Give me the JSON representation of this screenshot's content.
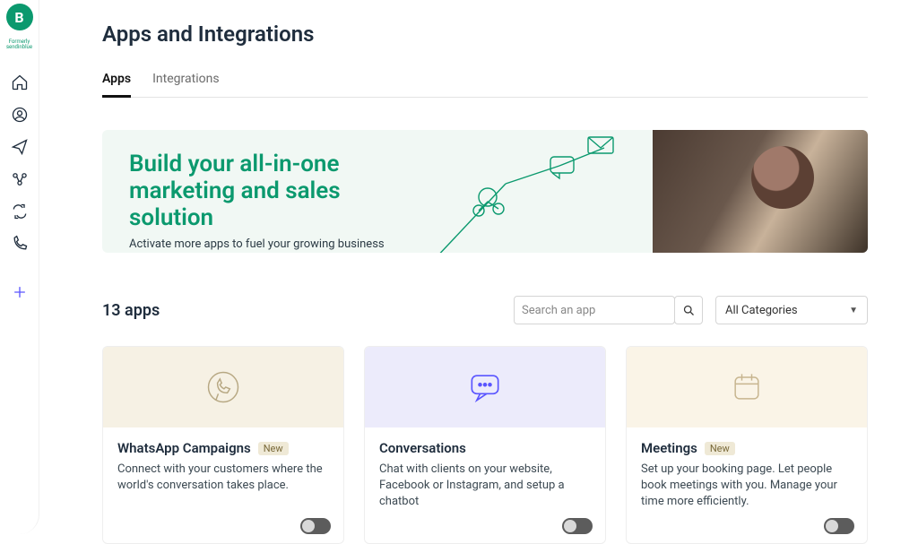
{
  "logo": {
    "letter": "B",
    "subtext": "Formerly\nsendinblue"
  },
  "sidebar": {
    "items": [
      {
        "name": "home"
      },
      {
        "name": "profile"
      },
      {
        "name": "campaigns"
      },
      {
        "name": "automations"
      },
      {
        "name": "transactional"
      },
      {
        "name": "phone"
      }
    ]
  },
  "page": {
    "title": "Apps and Integrations",
    "tabs": [
      {
        "label": "Apps",
        "active": true
      },
      {
        "label": "Integrations",
        "active": false
      }
    ]
  },
  "banner": {
    "title": "Build your all-in-one marketing and sales solution",
    "subtitle": "Activate more apps to fuel your growing business"
  },
  "apps": {
    "count_label": "13 apps",
    "search_placeholder": "Search an app",
    "category_label": "All Categories"
  },
  "cards": [
    {
      "title": "WhatsApp Campaigns",
      "badge": "New",
      "desc": "Connect with your customers where the world's conversation takes place.",
      "toggle": false
    },
    {
      "title": "Conversations",
      "badge": null,
      "desc": "Chat with clients on your website, Facebook or Instagram, and setup a chatbot",
      "toggle": false
    },
    {
      "title": "Meetings",
      "badge": "New",
      "desc": "Set up your booking page. Let people book meetings with you. Manage your time more efficiently.",
      "toggle": false
    }
  ]
}
